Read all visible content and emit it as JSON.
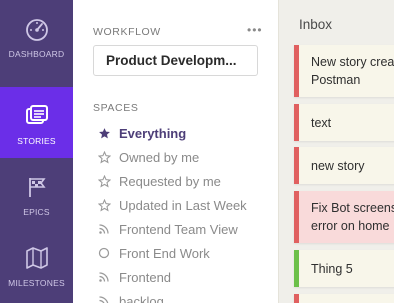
{
  "nav": {
    "items": [
      {
        "label": "DASHBOARD",
        "icon": "gauge-icon"
      },
      {
        "label": "STORIES",
        "icon": "stories-icon"
      },
      {
        "label": "EPICS",
        "icon": "flags-icon"
      },
      {
        "label": "MILESTONES",
        "icon": "map-icon"
      }
    ]
  },
  "panel": {
    "workflow_title": "WORKFLOW",
    "more": "•••",
    "workflow_value": "Product Developm...",
    "spaces_title": "SPACES",
    "spaces": [
      {
        "label": "Everything",
        "icon": "star-filled-icon"
      },
      {
        "label": "Owned by me",
        "icon": "star-outline-icon"
      },
      {
        "label": "Requested by me",
        "icon": "star-outline-icon"
      },
      {
        "label": "Updated in Last Week",
        "icon": "star-outline-icon"
      },
      {
        "label": "Frontend Team View",
        "icon": "rss-icon"
      },
      {
        "label": "Front End Work",
        "icon": "circle-icon"
      },
      {
        "label": "Frontend",
        "icon": "rss-icon"
      },
      {
        "label": "backlog",
        "icon": "rss-icon"
      }
    ]
  },
  "column": {
    "title": "Inbox",
    "cards": [
      {
        "text": "New story crea\nPostman",
        "color": "#e06060"
      },
      {
        "text": "text",
        "color": "#e06060"
      },
      {
        "text": "new story",
        "color": "#e06060"
      },
      {
        "text": "Fix Bot screens\nerror on home",
        "color": "#e06060"
      },
      {
        "text": "Thing 5",
        "color": "#6cc04a"
      }
    ]
  },
  "colors": {
    "nav_bg": "#4d3e78",
    "nav_active": "#6b2ee8",
    "accent_purple": "#4d3e78",
    "card_red": "#e06060",
    "card_green": "#6cc04a"
  }
}
